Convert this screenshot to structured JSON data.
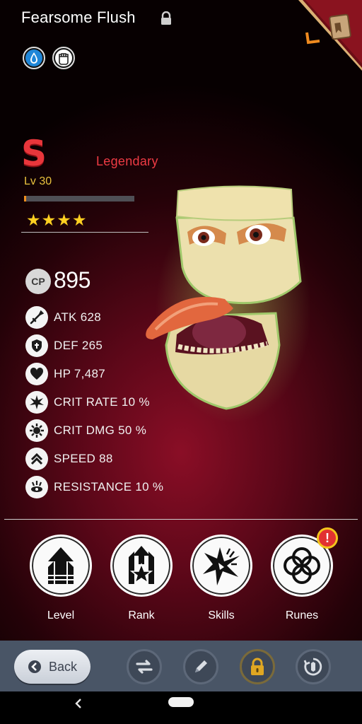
{
  "header": {
    "title": "Fearsome Flush",
    "element_icons": [
      "water-drop-icon",
      "fist-icon"
    ],
    "corner_icon": "codex-book-icon"
  },
  "rank": {
    "letter": "S",
    "rarity": "Legendary",
    "level": "Lv 30",
    "xp_fraction": 0.02,
    "stars": 4,
    "stars_text": "★★★★"
  },
  "combat_power": {
    "badge": "CP",
    "value": "895"
  },
  "stats": [
    {
      "icon": "sword-icon",
      "label": "ATK 628"
    },
    {
      "icon": "shield-icon",
      "label": "DEF 265"
    },
    {
      "icon": "heart-icon",
      "label": "HP 7,487"
    },
    {
      "icon": "crit-rate-icon",
      "label": "CRIT RATE 10 %"
    },
    {
      "icon": "crit-dmg-icon",
      "label": "CRIT DMG 50 %"
    },
    {
      "icon": "speed-icon",
      "label": "SPEED 88"
    },
    {
      "icon": "resistance-icon",
      "label": "RESISTANCE 10 %"
    }
  ],
  "actions": [
    {
      "label": "Level",
      "icon": "level-up-icon"
    },
    {
      "label": "Rank",
      "icon": "rank-up-icon"
    },
    {
      "label": "Skills",
      "icon": "skills-icon"
    },
    {
      "label": "Runes",
      "icon": "runes-icon",
      "alert": "!"
    }
  ],
  "bottom_bar": {
    "back_label": "Back",
    "buttons": [
      "swap-icon",
      "rename-icon",
      "lock-icon",
      "evolve-icon"
    ]
  },
  "colors": {
    "rarity": "#ee3b44",
    "level": "#e9c23e",
    "xp": "#ef8f1f",
    "stars": "#ffd021",
    "bottom_bar": "#495566"
  }
}
